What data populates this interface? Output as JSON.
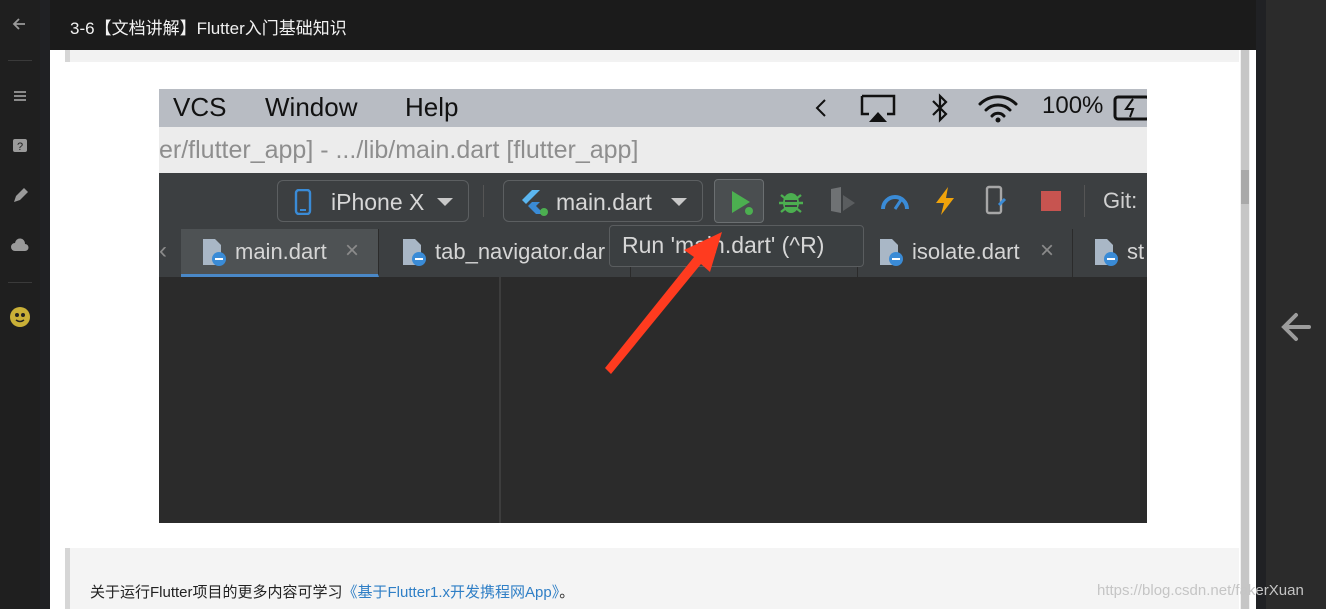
{
  "header": {
    "title": "3-6【文档讲解】Flutter入门基础知识"
  },
  "rail": {
    "icons": [
      "back-arrow-icon",
      "menu-icon",
      "help-icon",
      "pencil-icon",
      "cloud-icon",
      "avatar"
    ]
  },
  "screenshot": {
    "mac_menu": [
      "VCS",
      "Window",
      "Help"
    ],
    "tray": {
      "battery": "100%"
    },
    "window_title": "er/flutter_app] - .../lib/main.dart [flutter_app]",
    "toolbar": {
      "device": "iPhone X",
      "config": "main.dart",
      "git_label": "Git:"
    },
    "tabs": [
      {
        "label": "main.dart",
        "active": true
      },
      {
        "label": "tab_navigator.dar",
        "active": false
      },
      {
        "label": "isolate.dart",
        "active": false
      },
      {
        "label": "st",
        "active": false
      }
    ],
    "tooltip": "Run 'main.dart' (^R)"
  },
  "note": {
    "prefix": "关于运行Flutter项目的更多内容可学习",
    "link": "《基于Flutter1.x开发携程网App》",
    "suffix": "。"
  },
  "watermark": "https://blog.csdn.net/fakerXuan",
  "colors": {
    "accent_link": "#2f7fc6",
    "arrow": "#ff3b1f",
    "run_green": "#4caf50"
  }
}
